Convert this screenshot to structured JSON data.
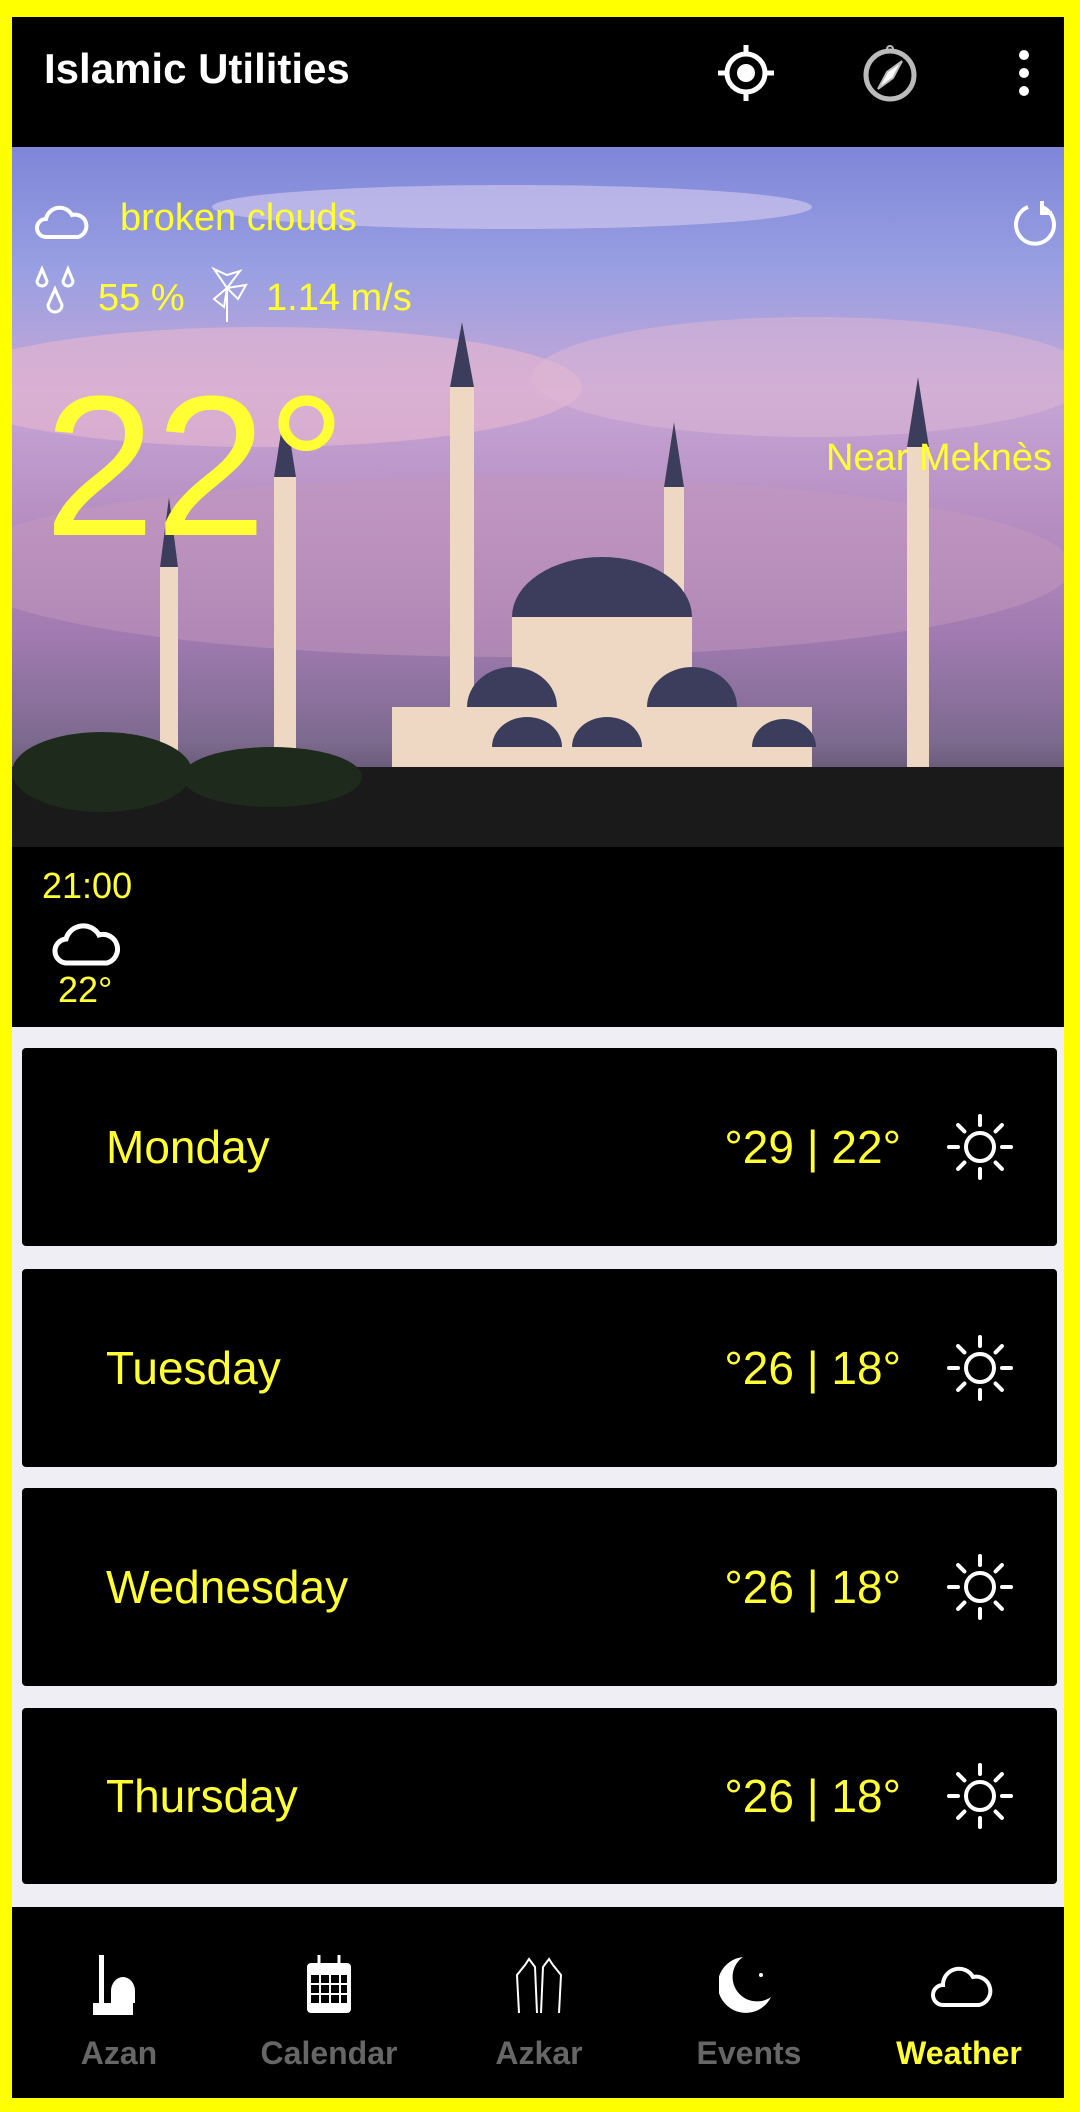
{
  "app": {
    "title": "Islamic Utilities",
    "icons": [
      "gps-locate-icon",
      "compass-icon",
      "more-vert-icon"
    ]
  },
  "current": {
    "condition": "broken clouds",
    "condition_icon": "cloud-icon",
    "humidity": "55 %",
    "wind": "1.14 m/s",
    "temperature": "22°",
    "location": "Near Meknès"
  },
  "hourly": [
    {
      "time": "21:00",
      "icon": "cloud-icon",
      "temp": "22°"
    }
  ],
  "daily": [
    {
      "day": "Monday",
      "temps": "°29 | 22°",
      "icon": "sun-icon"
    },
    {
      "day": "Tuesday",
      "temps": "°26 | 18°",
      "icon": "sun-icon"
    },
    {
      "day": "Wednesday",
      "temps": "°26 | 18°",
      "icon": "sun-icon"
    },
    {
      "day": "Thursday",
      "temps": "°26 | 18°",
      "icon": "sun-icon"
    }
  ],
  "nav": [
    {
      "label": "Azan"
    },
    {
      "label": "Calendar"
    },
    {
      "label": "Azkar"
    },
    {
      "label": "Events"
    },
    {
      "label": "Weather",
      "active": true
    }
  ],
  "colors": {
    "accent": "#ffff33",
    "inactive": "#666666",
    "frame": "#ffff00"
  }
}
